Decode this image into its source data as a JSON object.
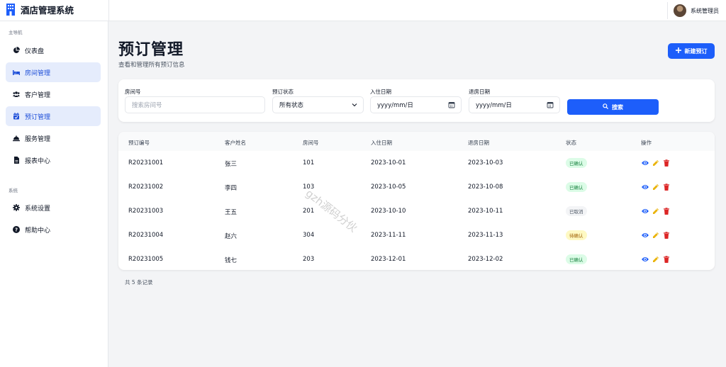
{
  "app": {
    "title": "酒店管理系统"
  },
  "header": {
    "user_name": "系统管理员"
  },
  "sidebar": {
    "section_main": "主导航",
    "section_system": "系统",
    "items": [
      {
        "label": "仪表盘",
        "icon": "chart-pie-icon"
      },
      {
        "label": "房间管理",
        "icon": "bed-icon",
        "active": true
      },
      {
        "label": "客户管理",
        "icon": "users-icon"
      },
      {
        "label": "预订管理",
        "icon": "calendar-check-icon",
        "active": true
      },
      {
        "label": "服务管理",
        "icon": "bell-concierge-icon"
      },
      {
        "label": "报表中心",
        "icon": "file-icon"
      },
      {
        "label": "系统设置",
        "icon": "gear-icon"
      },
      {
        "label": "帮助中心",
        "icon": "question-icon"
      }
    ]
  },
  "page": {
    "title": "预订管理",
    "subtitle": "查看和管理所有预订信息",
    "new_button": "新建预订"
  },
  "filters": {
    "room_label": "房间号",
    "room_placeholder": "搜索房间号",
    "status_label": "预订状态",
    "status_value": "所有状态",
    "checkin_label": "入住日期",
    "checkin_value": "yyyy/mm/日",
    "checkout_label": "退房日期",
    "checkout_value": "yyyy/mm/日",
    "search_button": "搜索"
  },
  "table": {
    "headers": [
      "预订编号",
      "客户姓名",
      "房间号",
      "入住日期",
      "退房日期",
      "状态",
      "操作"
    ],
    "rows": [
      {
        "id": "R20231001",
        "name": "张三",
        "room": "101",
        "checkin": "2023-10-01",
        "checkout": "2023-10-03",
        "status": "已确认"
      },
      {
        "id": "R20231002",
        "name": "李四",
        "room": "103",
        "checkin": "2023-10-05",
        "checkout": "2023-10-08",
        "status": "已确认"
      },
      {
        "id": "R20231003",
        "name": "王五",
        "room": "201",
        "checkin": "2023-10-10",
        "checkout": "2023-10-11",
        "status": "已取消"
      },
      {
        "id": "R20231004",
        "name": "赵六",
        "room": "304",
        "checkin": "2023-11-11",
        "checkout": "2023-11-13",
        "status": "待确认"
      },
      {
        "id": "R20231005",
        "name": "钱七",
        "room": "203",
        "checkin": "2023-12-01",
        "checkout": "2023-12-02",
        "status": "已确认"
      }
    ]
  },
  "footer": {
    "record_count": "共 5 条记录"
  },
  "watermark": "gzh源码分伙",
  "colors": {
    "primary": "#1d5efa",
    "confirmed_bg": "#dcfce7",
    "confirmed_fg": "#15803d",
    "cancelled_bg": "#f3f4f6",
    "cancelled_fg": "#4b5563",
    "pending_bg": "#fef9c3",
    "pending_fg": "#a16207",
    "view": "#1d5efa",
    "edit": "#eab308",
    "delete": "#dc2626"
  }
}
